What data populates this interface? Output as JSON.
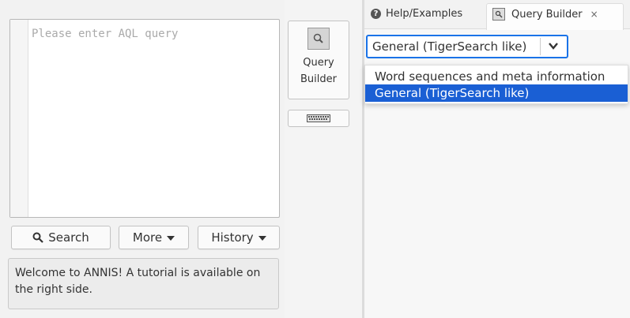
{
  "query": {
    "placeholder": "Please enter AQL query"
  },
  "buttons": {
    "search_label": "Search",
    "more_label": "More",
    "history_label": "History",
    "query_builder_line1": "Query",
    "query_builder_line2": "Builder"
  },
  "welcome": {
    "text": "Welcome to ANNIS! A tutorial is available on the right side."
  },
  "tabs": [
    {
      "label": "Help/Examples",
      "icon": "info-circle-icon"
    },
    {
      "label": "Query Builder",
      "icon": "query-builder-icon",
      "closable": true
    }
  ],
  "builder_select": {
    "selected": "General (TigerSearch like)",
    "options": [
      "Word sequences and meta information",
      "General (TigerSearch like)"
    ]
  },
  "colors": {
    "accent": "#1a73e8",
    "selection": "#1a5fd4"
  }
}
